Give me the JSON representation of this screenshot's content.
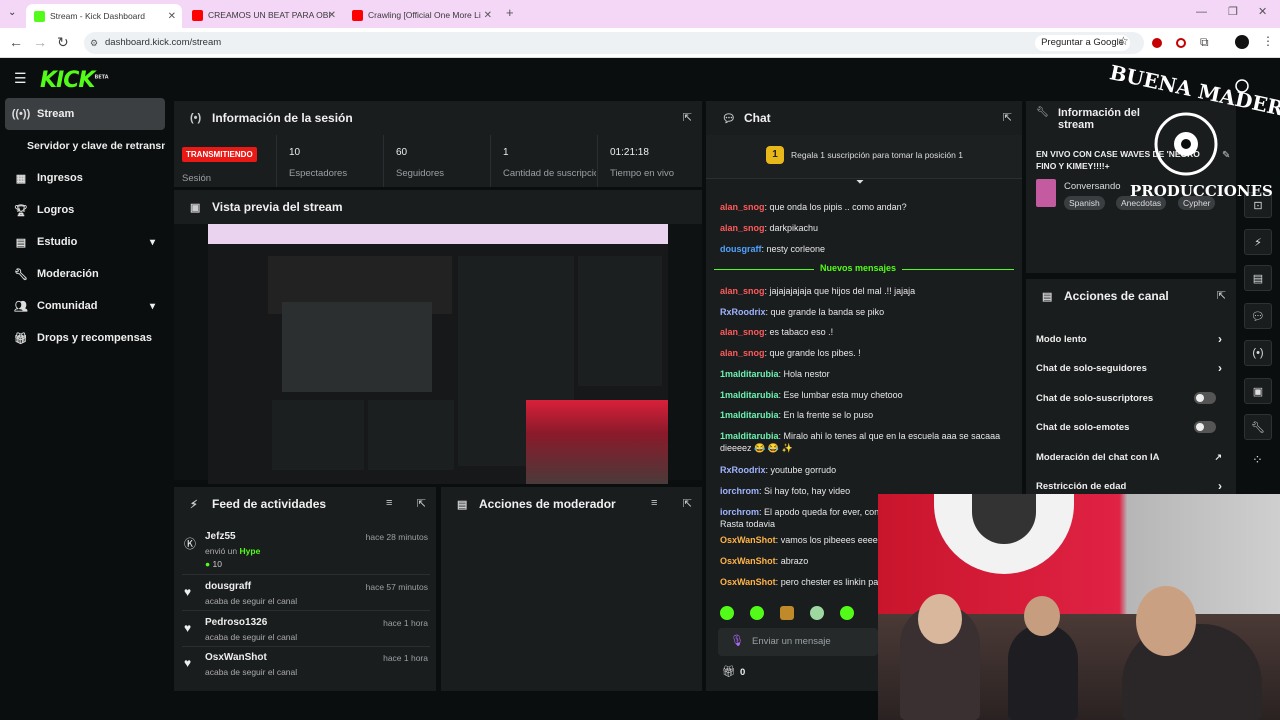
{
  "browser": {
    "tabs": [
      {
        "title": "Stream - Kick Dashboard",
        "color": "#53fc18"
      },
      {
        "title": "CREAMOS UN BEAT PARA OBI",
        "color": "#ff0000"
      },
      {
        "title": "Crawling [Official One More Li",
        "color": "#ff0000"
      }
    ],
    "url": "dashboard.kick.com/stream",
    "ask_google": "Preguntar a Google"
  },
  "sidebar": {
    "logo": "KICK",
    "logo_tag": "BETA",
    "items": [
      {
        "label": "Stream",
        "icon": "broadcast-icon"
      },
      {
        "label": "Servidor y clave de retransmisión"
      },
      {
        "label": "Ingresos",
        "icon": "chart-icon"
      },
      {
        "label": "Logros",
        "icon": "trophy-icon"
      },
      {
        "label": "Estudio",
        "icon": "studio-icon"
      },
      {
        "label": "Moderación",
        "icon": "wrench-icon"
      },
      {
        "label": "Comunidad",
        "icon": "community-icon"
      },
      {
        "label": "Drops y recompensas",
        "icon": "gift-icon"
      }
    ]
  },
  "session": {
    "title": "Información de la sesión",
    "status": "TRANSMITIENDO",
    "status_label": "Sesión",
    "stats": [
      {
        "value": "10",
        "label": "Espectadores"
      },
      {
        "value": "60",
        "label": "Seguidores"
      },
      {
        "value": "1",
        "label": "Cantidad de suscripciones"
      },
      {
        "value": "01:21:18",
        "label": "Tiempo en vivo"
      }
    ]
  },
  "preview": {
    "title": "Vista previa del stream"
  },
  "feed": {
    "title": "Feed de actividades",
    "items": [
      {
        "user": "Jefz55",
        "time": "hace 28 minutos",
        "desc": "envió un",
        "extra": "Hype",
        "amount": "10"
      },
      {
        "user": "dousgraff",
        "time": "hace 57 minutos",
        "desc": "acaba de seguir el canal"
      },
      {
        "user": "Pedroso1326",
        "time": "hace 1 hora",
        "desc": "acaba de seguir el canal"
      },
      {
        "user": "OsxWanShot",
        "time": "hace 1 hora",
        "desc": "acaba de seguir el canal"
      }
    ]
  },
  "mod_actions": {
    "title": "Acciones de moderador"
  },
  "chat": {
    "title": "Chat",
    "gift_position": "1",
    "gift_text": "Regala 1 suscripción para tomar la posición 1",
    "new_messages": "Nuevos mensajes",
    "messages": [
      {
        "user": "alan_snog",
        "text": "que onda los pipis .. como andan?",
        "color": "#ff5a5a"
      },
      {
        "user": "alan_snog",
        "text": "darkpikachu",
        "color": "#ff5a5a"
      },
      {
        "user": "dousgraff",
        "text": "nesty corleone",
        "color": "#4fa3ff"
      },
      {
        "user": "alan_snog",
        "text": "jajajajajaja que hijos del mal .!! jajaja",
        "color": "#ff5a5a"
      },
      {
        "user": "RxRoodrix",
        "text": "que grande la banda se piko",
        "color": "#9fb3ff"
      },
      {
        "user": "alan_snog",
        "text": "es tabaco eso .!",
        "color": "#ff5a5a"
      },
      {
        "user": "alan_snog",
        "text": "que grande los pibes. !",
        "color": "#ff5a5a"
      },
      {
        "user": "1malditarubia",
        "text": "Hola nestor",
        "color": "#6cf2b2"
      },
      {
        "user": "1malditarubia",
        "text": "Ese lumbar esta muy chetooo",
        "color": "#6cf2b2"
      },
      {
        "user": "1malditarubia",
        "text": "En la frente se lo puso",
        "color": "#6cf2b2"
      },
      {
        "user": "1malditarubia",
        "text": "Miralo ahi lo tenes al que en la escuela aaa se sacaaa dieeeez 😂 😂 ✨",
        "color": "#6cf2b2"
      },
      {
        "user": "RxRoodrix",
        "text": "youtube gorrudo",
        "color": "#9fb3ff"
      },
      {
        "user": "iorchrom",
        "text": "Si hay foto, hay video",
        "color": "#9fb3ff"
      },
      {
        "user": "iorchrom",
        "text": "El apodo queda for ever, con Rasta todavia",
        "color": "#9fb3ff"
      },
      {
        "user": "OsxWanShot",
        "text": "vamos los pibeees eeee",
        "color": "#ffb347"
      },
      {
        "user": "OsxWanShot",
        "text": "abrazo",
        "color": "#ffb347"
      },
      {
        "user": "OsxWanShot",
        "text": "pero chester es linkin pa",
        "color": "#ffb347"
      }
    ],
    "input_placeholder": "Enviar un mensaje",
    "points": "0"
  },
  "stream_info": {
    "title": "Información del stream",
    "stream_title": "EN VIVO CON CASE WAVES DE 'NEGRO FINO Y KIMEY!!!!+",
    "category": "Conversando",
    "tags": [
      "Spanish",
      "Anecdotas",
      "Cypher"
    ]
  },
  "channel_actions": {
    "title": "Acciones de canal",
    "items": [
      {
        "label": "Modo lento",
        "control": "chevron"
      },
      {
        "label": "Chat de solo-seguidores",
        "control": "chevron"
      },
      {
        "label": "Chat de solo-suscriptores",
        "control": "toggle"
      },
      {
        "label": "Chat de solo-emotes",
        "control": "toggle"
      },
      {
        "label": "Moderación del chat con IA",
        "control": "external"
      },
      {
        "label": "Restricción de edad",
        "control": "chevron"
      }
    ]
  },
  "overlay": {
    "line1": "BUENA MADERA",
    "line2": "PRODUCCIONES"
  },
  "colors": {
    "accent": "#53fc18",
    "live": "#e91916",
    "panel": "#1a1d1e",
    "bg": "#0b0e0f"
  }
}
